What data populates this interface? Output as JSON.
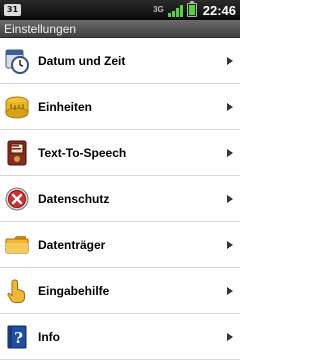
{
  "status_bar": {
    "notification_badge": "31",
    "network_label": "3G",
    "signal_icon": "signal-bars-icon",
    "battery_icon": "battery-icon",
    "time": "22:46",
    "signal_color": "#55d13a"
  },
  "title_bar": {
    "title": "Einstellungen"
  },
  "settings": {
    "items": [
      {
        "label": "Datum und Zeit",
        "icon": "calendar-clock-icon"
      },
      {
        "label": "Einheiten",
        "icon": "measuring-tape-icon"
      },
      {
        "label": "Text-To-Speech",
        "icon": "speech-device-icon"
      },
      {
        "label": "Datenschutz",
        "icon": "privacy-x-icon"
      },
      {
        "label": "Datenträger",
        "icon": "folder-icon"
      },
      {
        "label": "Eingabehilfe",
        "icon": "pointing-hand-icon"
      },
      {
        "label": "Info",
        "icon": "info-book-icon"
      }
    ]
  }
}
